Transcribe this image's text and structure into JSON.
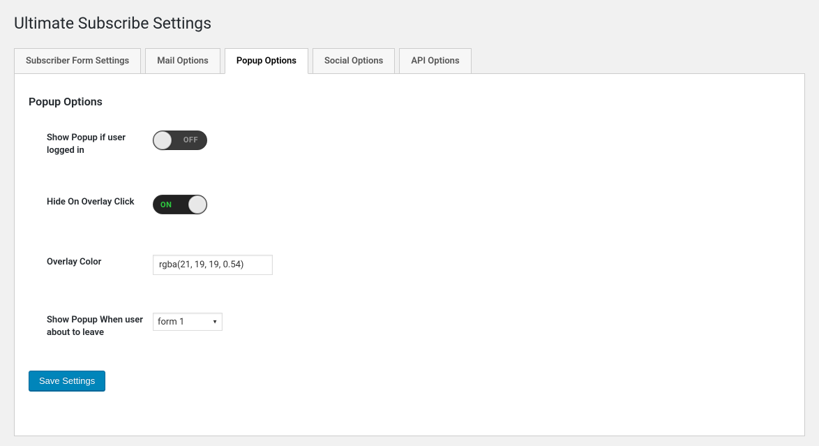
{
  "page": {
    "title": "Ultimate Subscribe Settings"
  },
  "tabs": [
    {
      "label": "Subscriber Form Settings",
      "active": false
    },
    {
      "label": "Mail Options",
      "active": false
    },
    {
      "label": "Popup Options",
      "active": true
    },
    {
      "label": "Social Options",
      "active": false
    },
    {
      "label": "API Options",
      "active": false
    }
  ],
  "section": {
    "title": "Popup Options"
  },
  "fields": {
    "show_popup_logged_in": {
      "label": "Show Popup if user logged in",
      "state": "off",
      "text": "OFF"
    },
    "hide_on_overlay_click": {
      "label": "Hide On Overlay Click",
      "state": "on",
      "text": "ON"
    },
    "overlay_color": {
      "label": "Overlay Color",
      "value": "rgba(21, 19, 19, 0.54)"
    },
    "show_popup_on_leave": {
      "label": "Show Popup When user about to leave",
      "selected": "form 1"
    }
  },
  "buttons": {
    "save": "Save Settings"
  }
}
